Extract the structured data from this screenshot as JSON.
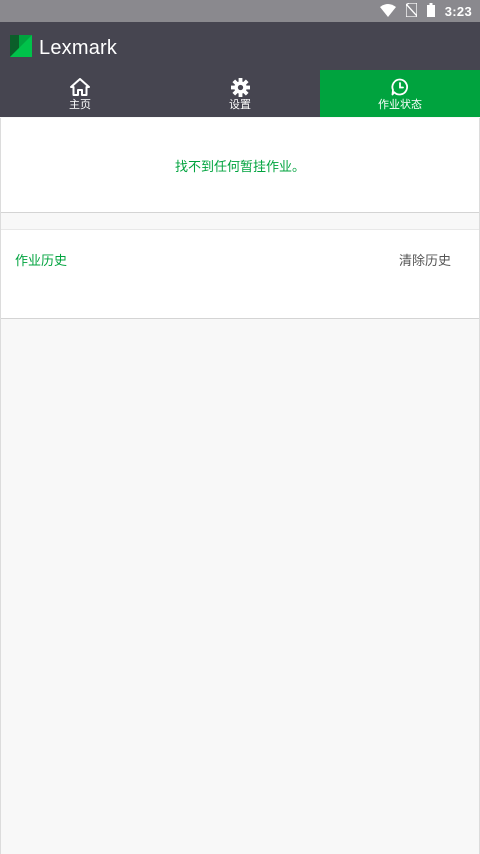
{
  "status_bar": {
    "time": "3:23",
    "icons": [
      "wifi-icon",
      "no-sim-icon",
      "battery-icon"
    ]
  },
  "app": {
    "brand": "Lexmark",
    "colors": {
      "bar": "#464550",
      "accent": "#00a33e",
      "statusbar": "#8a898e"
    }
  },
  "tabs": [
    {
      "label": "主页",
      "icon": "home-icon",
      "active": false
    },
    {
      "label": "设置",
      "icon": "gear-icon",
      "active": false
    },
    {
      "label": "作业状态",
      "icon": "job-status-icon",
      "active": true
    }
  ],
  "held_jobs": {
    "empty_message": "找不到任何暂挂作业。"
  },
  "history": {
    "title": "作业历史",
    "clear_label": "清除历史"
  }
}
